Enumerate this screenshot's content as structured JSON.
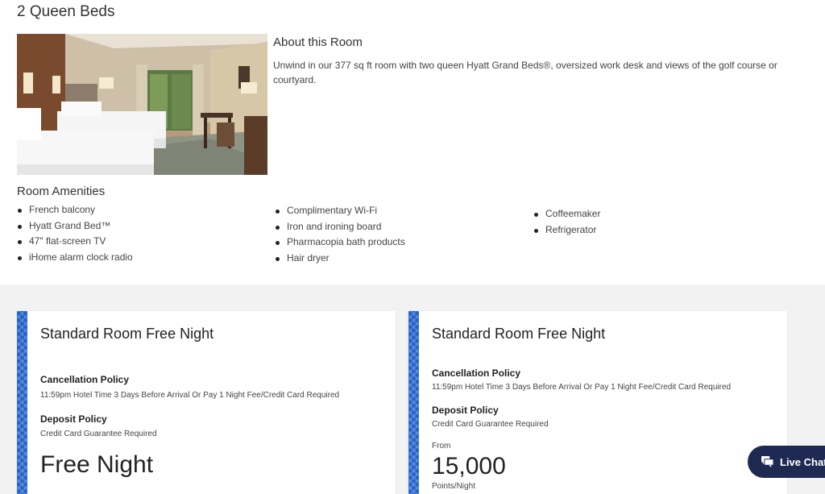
{
  "room": {
    "title": "2 Queen Beds",
    "about_title": "About this Room",
    "about_text": "Unwind in our 377 sq ft room with two queen Hyatt Grand Beds®, oversized work desk and views of the golf course or courtyard."
  },
  "amenities": {
    "title": "Room Amenities",
    "col1": [
      "French balcony",
      "Hyatt Grand Bed™",
      "47\" flat-screen TV",
      "iHome alarm clock radio"
    ],
    "col2": [
      "Complimentary Wi-Fi",
      "Iron and ironing board",
      "Pharmacopia bath products",
      "Hair dryer"
    ],
    "col3": [
      "Coffeemaker",
      "Refrigerator"
    ]
  },
  "rates": [
    {
      "title": "Standard Room Free Night",
      "cancel_label": "Cancellation Policy",
      "cancel_text": "11:59pm Hotel Time 3 Days Before Arrival Or Pay 1 Night Fee/Credit Card Required",
      "deposit_label": "Deposit Policy",
      "deposit_text": "Credit Card Guarantee Required",
      "price": "Free Night"
    },
    {
      "title": "Standard Room Free Night",
      "cancel_label": "Cancellation Policy",
      "cancel_text": "11:59pm Hotel Time 3 Days Before Arrival Or Pay 1 Night Fee/Credit Card Required",
      "deposit_label": "Deposit Policy",
      "deposit_text": "Credit Card Guarantee Required",
      "from_label": "From",
      "points": "15,000",
      "points_unit": "Points/Night"
    }
  ],
  "live_chat": {
    "label": "Live Chat",
    "icon": "chat-bubble-icon"
  },
  "colors": {
    "stripe": "#2563c9",
    "chat_bg": "#1e2a52",
    "section_bg": "#f2f2f2"
  }
}
